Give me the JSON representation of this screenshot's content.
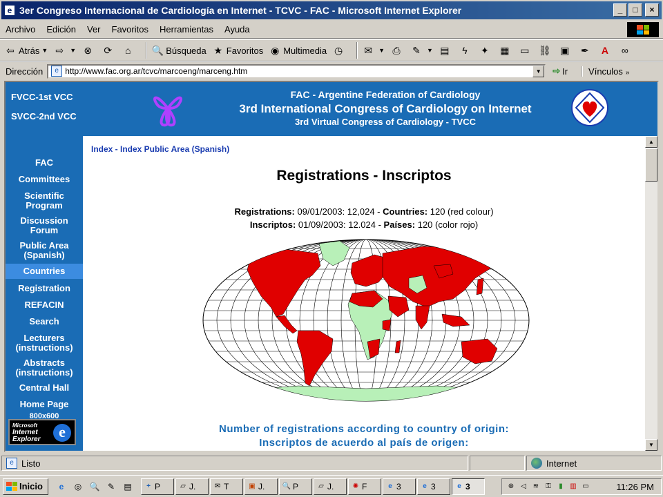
{
  "window": {
    "title": "3er Congreso Internacional de Cardiología en Internet - TCVC - FAC - Microsoft Internet Explorer",
    "buttons": {
      "minimize": "_",
      "maximize": "□",
      "close": "×"
    }
  },
  "menu": [
    "Archivo",
    "Edición",
    "Ver",
    "Favoritos",
    "Herramientas",
    "Ayuda"
  ],
  "toolbar": {
    "back": "Atrás",
    "search": "Búsqueda",
    "favorites": "Favoritos",
    "multimedia": "Multimedia"
  },
  "address": {
    "label": "Dirección",
    "url": "http://www.fac.org.ar/tcvc/marcoeng/marceng.htm",
    "go": "Ir",
    "links": "Vínculos"
  },
  "banner": {
    "link1": "FVCC-1st VCC",
    "link2": "SVCC-2nd VCC",
    "line1": "FAC - Argentine Federation of Cardiology",
    "line2": "3rd International Congress of Cardiology on Internet",
    "line3": "3rd Virtual Congress of Cardiology - TVCC"
  },
  "nav": {
    "items": [
      {
        "label": "FAC"
      },
      {
        "label": "Committees"
      },
      {
        "label": "Scientific Program"
      },
      {
        "label": "Discussion Forum"
      },
      {
        "label": "Public Area (Spanish)"
      },
      {
        "label": "Countries"
      },
      {
        "label": "Registration"
      },
      {
        "label": "REFACIN"
      },
      {
        "label": "Search"
      },
      {
        "label": "Lecturers (instructions)"
      },
      {
        "label": "Abstracts (instructions)"
      },
      {
        "label": "Central Hall"
      },
      {
        "label": "Home Page"
      },
      {
        "label": "800x600"
      }
    ],
    "ie_badge": {
      "line1": "Microsoft",
      "line2": "Internet",
      "line3": "Explorer"
    }
  },
  "content": {
    "breadcrumb": "Index - Index Public Area (Spanish)",
    "title": "Registrations - Inscriptos",
    "stats_en": {
      "label1": "Registrations:",
      "value1": "09/01/2003: 12,024 -",
      "label2": "Countries:",
      "value2": "120 (red colour)"
    },
    "stats_es": {
      "label1": "Inscriptos:",
      "value1": "01/09/2003: 12.024 -",
      "label2": "Países:",
      "value2": "120 (color rojo)"
    },
    "caption1": "Number of registrations according to country of origin:",
    "caption2": "Inscriptos de acuerdo al país de origen:"
  },
  "status": {
    "text": "Listo",
    "zone": "Internet"
  },
  "taskbar": {
    "start": "Inicio",
    "tasks": [
      "P",
      "J.",
      "T",
      "J.",
      "P",
      "J.",
      "F",
      "3",
      "3",
      "3"
    ],
    "clock": "11:26 PM"
  },
  "colors": {
    "banner": "#1a6cb5",
    "nav_active": "#3c8ce0",
    "map_red": "#e00000",
    "map_green": "#b8f0b8"
  }
}
